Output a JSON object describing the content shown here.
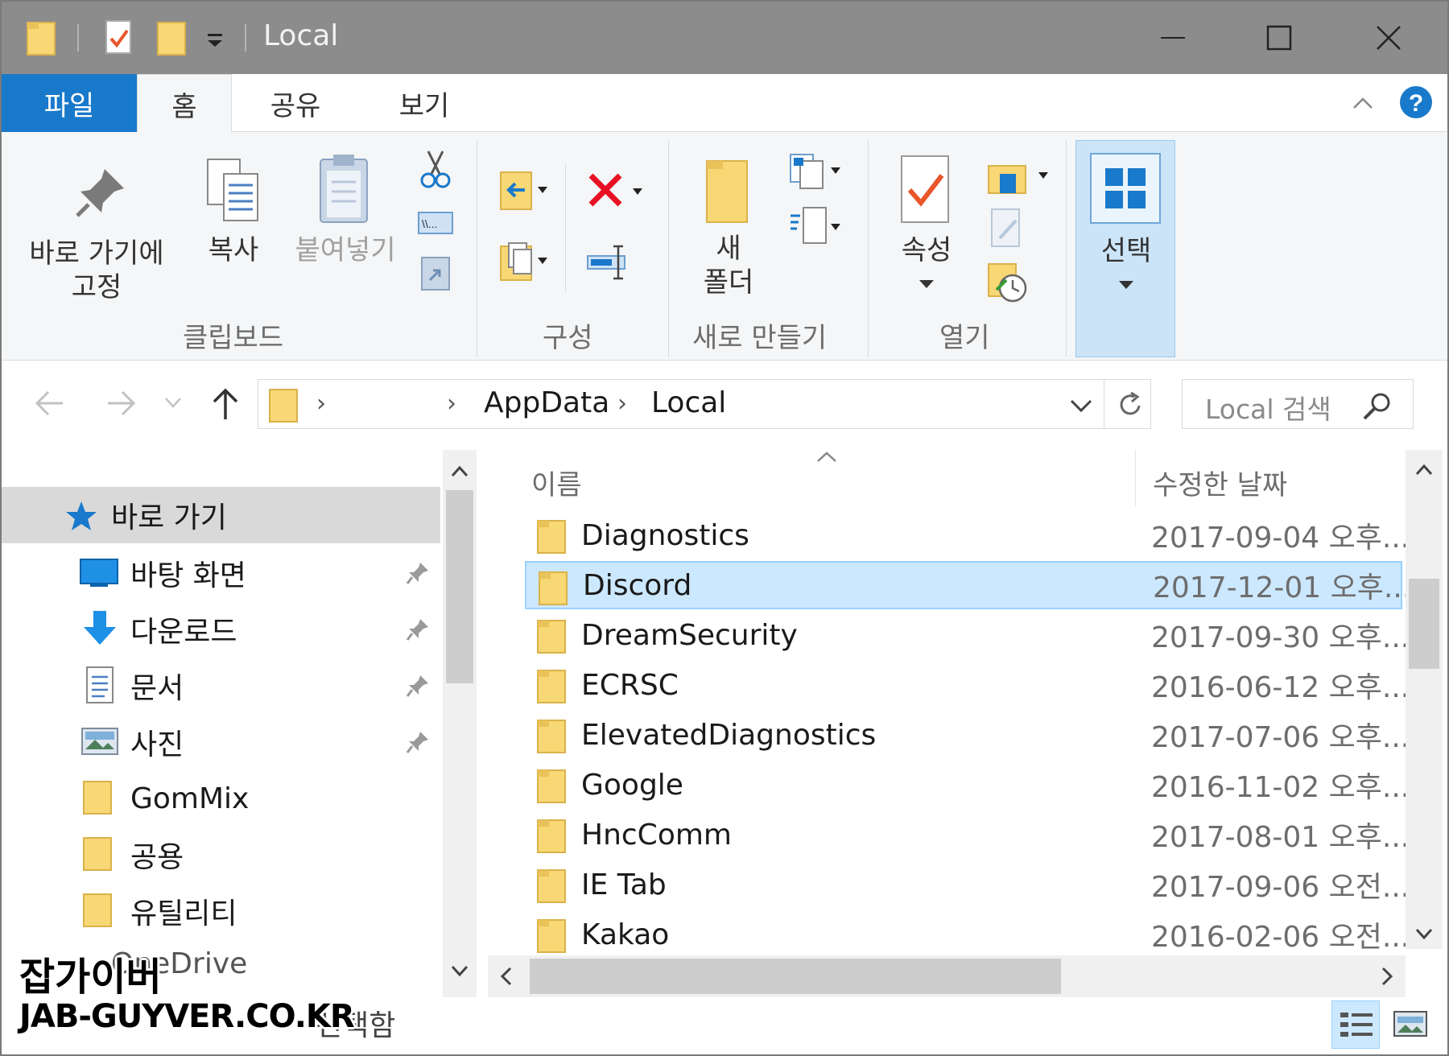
{
  "window": {
    "title": "Local"
  },
  "ribbon_tabs": [
    "파일",
    "홈",
    "공유",
    "보기"
  ],
  "ribbon": {
    "clipboard": {
      "pin_line1": "바로 가기에",
      "pin_line2": "고정",
      "copy": "복사",
      "paste": "붙여넣기",
      "group": "클립보드"
    },
    "organize": {
      "group": "구성"
    },
    "new": {
      "folder_line1": "새",
      "folder_line2": "폴더",
      "group": "새로 만들기"
    },
    "open": {
      "properties": "속성",
      "group": "열기"
    },
    "select": {
      "label": "선택"
    }
  },
  "address": {
    "crumbs": [
      "AppData",
      "Local"
    ],
    "search_placeholder": "Local 검색"
  },
  "nav": {
    "quick_access": "바로 가기",
    "items": [
      "바탕 화면",
      "다운로드",
      "문서",
      "사진",
      "GomMix",
      "공용",
      "유틸리티"
    ],
    "partial": "OneDrive"
  },
  "columns": {
    "name": "이름",
    "modified": "수정한 날짜"
  },
  "files": [
    {
      "name": "Diagnostics",
      "date": "2017-09-04 오후..."
    },
    {
      "name": "Discord",
      "date": "2017-12-01 오후..."
    },
    {
      "name": "DreamSecurity",
      "date": "2017-09-30 오후..."
    },
    {
      "name": "ECRSC",
      "date": "2016-06-12 오후..."
    },
    {
      "name": "ElevatedDiagnostics",
      "date": "2017-07-06 오후..."
    },
    {
      "name": "Google",
      "date": "2016-11-02 오후..."
    },
    {
      "name": "HncComm",
      "date": "2017-08-01 오후..."
    },
    {
      "name": "IE Tab",
      "date": "2017-09-06 오전..."
    },
    {
      "name": "Kakao",
      "date": "2016-02-06 오전..."
    }
  ],
  "status": {
    "text": "선택함"
  },
  "watermark": {
    "line1": "잡가이버",
    "line2": "JAB-GUYVER.CO.KR"
  },
  "colors": {
    "accent": "#1979ca",
    "selection": "#cce8ff",
    "titlebar": "#8c8c8c",
    "folder": "#f8d775"
  }
}
